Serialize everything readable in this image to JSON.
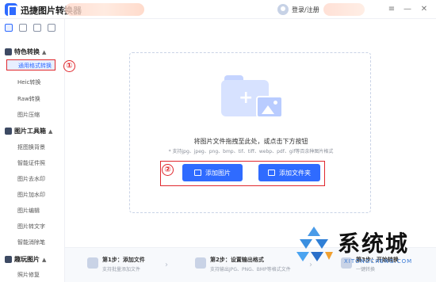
{
  "app": {
    "title": "迅捷图片转换器",
    "login_label": "登录/注册"
  },
  "window_controls": [
    "≡",
    "—",
    "✕"
  ],
  "sidebar": {
    "groups": [
      {
        "label": "特色转换",
        "items": [
          "通用格式转换",
          "Heic转换",
          "Raw转换",
          "图片压缩"
        ]
      },
      {
        "label": "图片工具箱",
        "items": [
          "抠图换背景",
          "智能证件照",
          "图片去水印",
          "图片加水印",
          "图片编辑",
          "图片转文字",
          "智能消除笔"
        ]
      },
      {
        "label": "趣玩图片",
        "items": [
          "照片修复"
        ]
      }
    ],
    "selected_item": "通用格式转换"
  },
  "annotations": [
    "①",
    "②"
  ],
  "dropzone": {
    "hint": "将图片文件拖拽至此处，或点击下方按钮",
    "formats": "* 支持jpg、jpeg、png、bmp、tif、tiff、webp、pdf、gif等百余种图片格式",
    "add_image_label": "添加图片",
    "add_folder_label": "添加文件夹"
  },
  "steps": [
    {
      "title": "第1步：添加文件",
      "desc": "支持批量添加文件"
    },
    {
      "title": "第2步：设置输出格式",
      "desc": "支持输出JPG、PNG、BMP等格式文件"
    },
    {
      "title": "第3步：开始转换",
      "desc": "一键转换"
    }
  ],
  "watermark": {
    "name": "系统城",
    "url": "XITONGCHENG.COM"
  },
  "colors": {
    "accent": "#2f6bff",
    "annotation": "#e0282e"
  }
}
